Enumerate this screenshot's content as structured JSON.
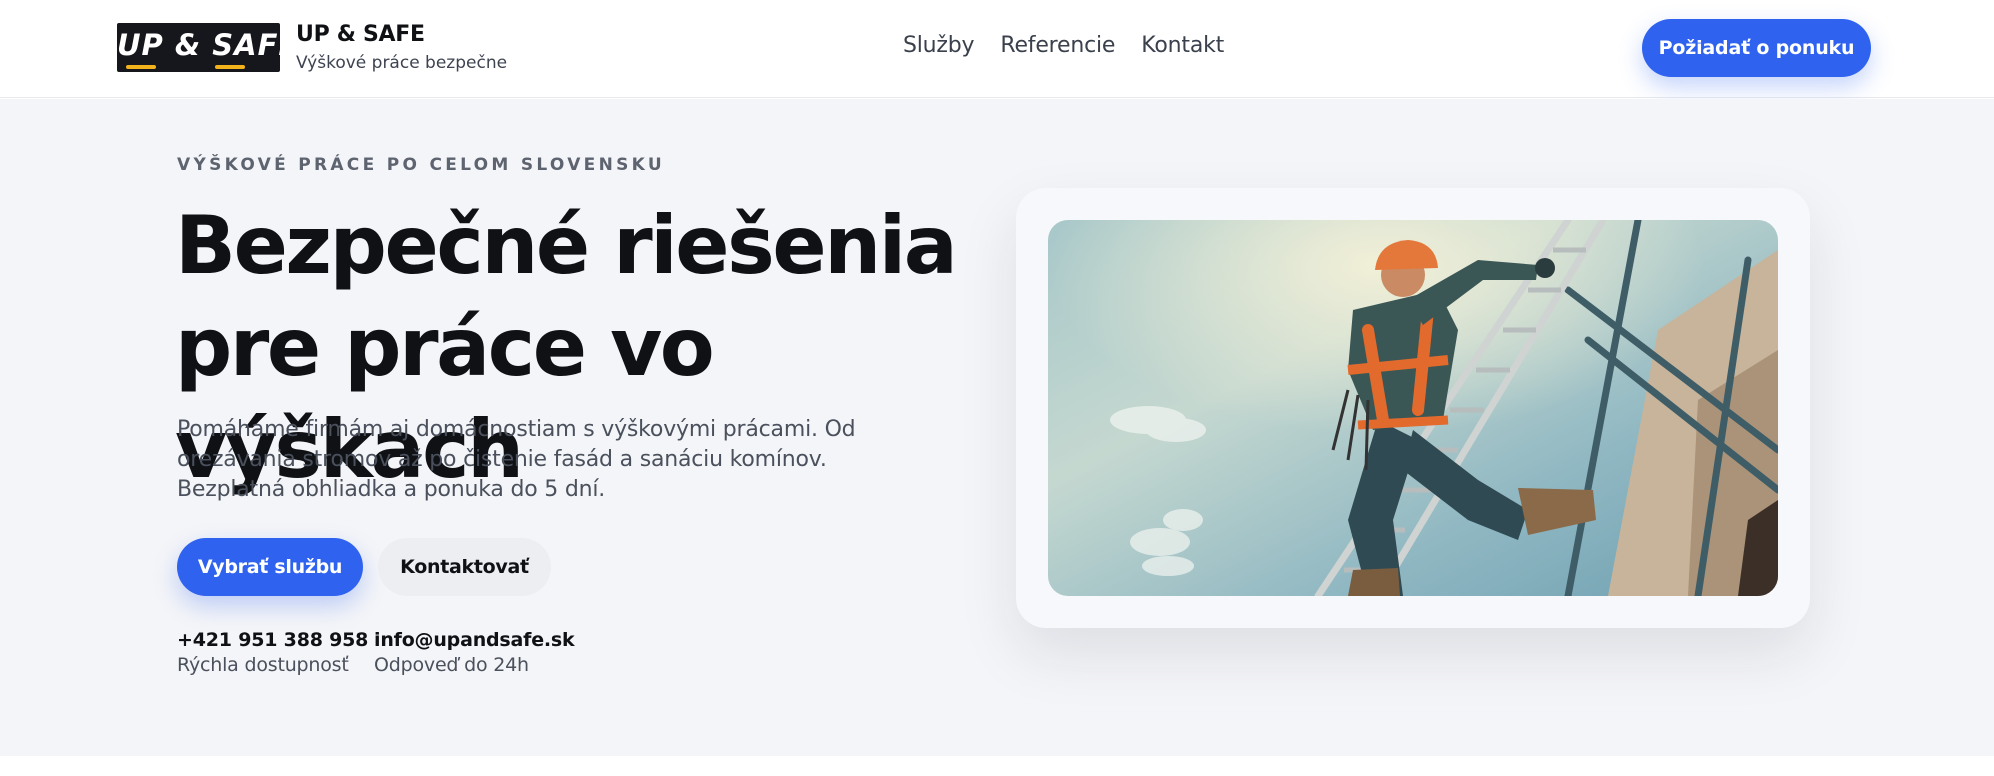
{
  "header": {
    "logo_text": "UP & SAFE",
    "brand_name": "UP & SAFE",
    "tagline": "Výškové práce bezpečne",
    "nav": [
      {
        "label": "Služby"
      },
      {
        "label": "Referencie"
      },
      {
        "label": "Kontakt"
      }
    ],
    "cta_label": "Požiadať o ponuku"
  },
  "hero": {
    "eyebrow": "VÝŠKOVÉ PRÁCE PO CELOM SLOVENSKU",
    "headline": "Bezpečné riešenia pre práce vo výškach",
    "lead": "Pomáhame firmám aj domácnostiam s výškovými prácami. Od orezávania stromov až po čistenie fasád a sanáciu komínov. Bezplatná obhliadka a ponuka do 5 dní.",
    "primary_button": "Vybrať službu",
    "secondary_button": "Kontaktovať",
    "contacts": [
      {
        "value": "+421 951 388 958",
        "note": "Rýchla dostupnosť"
      },
      {
        "value": "info@upandsafe.sk",
        "note": "Odpoveď do 24h"
      }
    ]
  },
  "colors": {
    "accent": "#2f63ef",
    "logo_background": "#15171c",
    "logo_swoosh": "#f2b21b",
    "hero_background": "#f4f5f8"
  }
}
